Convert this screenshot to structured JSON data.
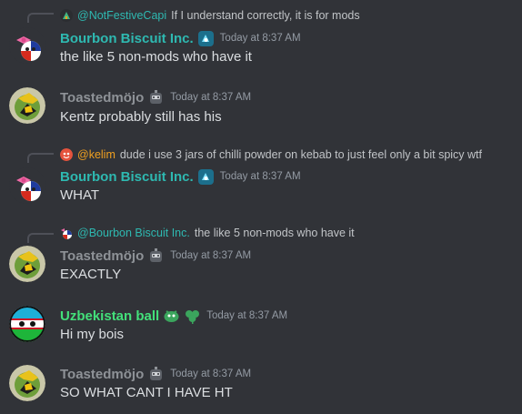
{
  "colors": {
    "background": "#313338",
    "bourbon_name": "#2eb9b1",
    "toast_name": "#8e9297",
    "uzbek_name": "#43e07a",
    "mention": "#2eb9b1",
    "kelim_name": "#f0a020"
  },
  "messages": [
    {
      "reply": {
        "name": "@NotFestiveCapi",
        "text": "If I understand correctly, it is for mods"
      },
      "username": "Bourbon Biscuit Inc.",
      "timestamp": "Today at 8:37 AM",
      "content": "the like 5 non-mods who have it"
    },
    {
      "username": "Toastedmöjo",
      "timestamp": "Today at 8:37 AM",
      "content": "Kentz probably still has his"
    },
    {
      "reply": {
        "name": "@kelim",
        "text": "dude i use 3 jars of chilli powder on kebab to just feel only a bit spicy wtf"
      },
      "username": "Bourbon Biscuit Inc.",
      "timestamp": "Today at 8:37 AM",
      "content": "WHAT"
    },
    {
      "reply": {
        "name": "@Bourbon Biscuit Inc.",
        "text": "the like 5 non-mods who have it"
      },
      "username": "Toastedmöjo",
      "timestamp": "Today at 8:37 AM",
      "content": "EXACTLY"
    },
    {
      "username": "Uzbekistan ball",
      "timestamp": "Today at 8:37 AM",
      "content": "Hi my bois"
    },
    {
      "username": "Toastedmöjo",
      "timestamp": "Today at 8:37 AM",
      "content": "SO WHAT CANT I HAVE HT"
    }
  ]
}
